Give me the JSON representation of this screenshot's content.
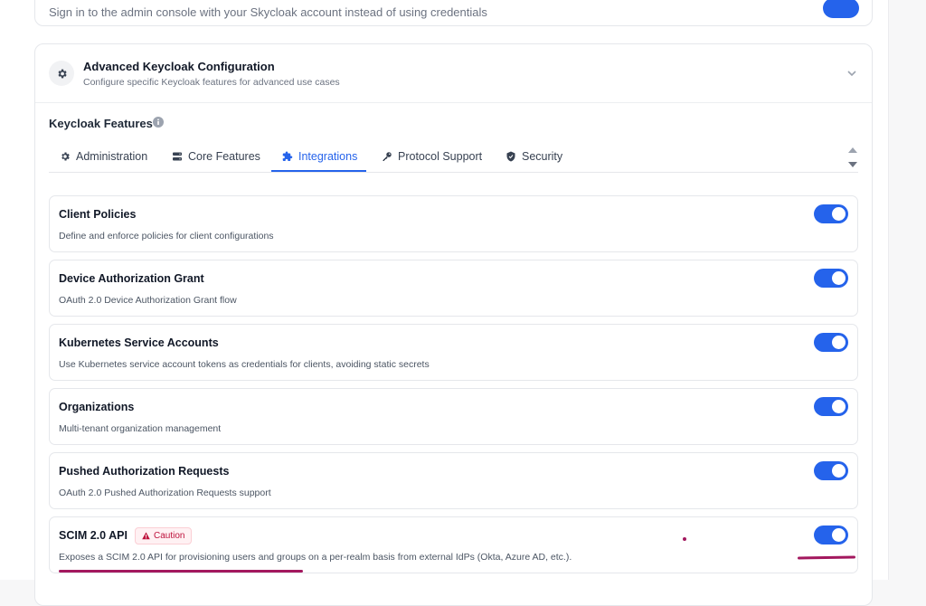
{
  "top_card": {
    "subtitle": "Sign in to the admin console with your Skycloak account instead of using credentials"
  },
  "advanced": {
    "title": "Advanced Keycloak Configuration",
    "subtitle": "Configure specific Keycloak features for advanced use cases"
  },
  "features_section": {
    "label": "Keycloak Features"
  },
  "tabs": [
    {
      "label": "Administration",
      "icon": "gear-icon"
    },
    {
      "label": "Core Features",
      "icon": "server-icon"
    },
    {
      "label": "Integrations",
      "icon": "puzzle-icon",
      "active": true
    },
    {
      "label": "Protocol Support",
      "icon": "key-icon"
    },
    {
      "label": "Security",
      "icon": "shield-icon"
    }
  ],
  "features": [
    {
      "title": "Client Policies",
      "description": "Define and enforce policies for client configurations",
      "enabled": true
    },
    {
      "title": "Device Authorization Grant",
      "description": "OAuth 2.0 Device Authorization Grant flow",
      "enabled": true
    },
    {
      "title": "Kubernetes Service Accounts",
      "description": "Use Kubernetes service account tokens as credentials for clients, avoiding static secrets",
      "enabled": true
    },
    {
      "title": "Organizations",
      "description": "Multi-tenant organization management",
      "enabled": true
    },
    {
      "title": "Pushed Authorization Requests",
      "description": "OAuth 2.0 Pushed Authorization Requests support",
      "enabled": true
    },
    {
      "title": "SCIM 2.0 API",
      "badge": "Caution",
      "description": "Exposes a SCIM 2.0 API for provisioning users and groups on a per-realm basis from external IdPs (Okta, Azure AD, etc.).",
      "enabled": true
    }
  ],
  "colors": {
    "accent": "#2563eb",
    "caution": "#be123c",
    "annotation": "#a3185e"
  }
}
